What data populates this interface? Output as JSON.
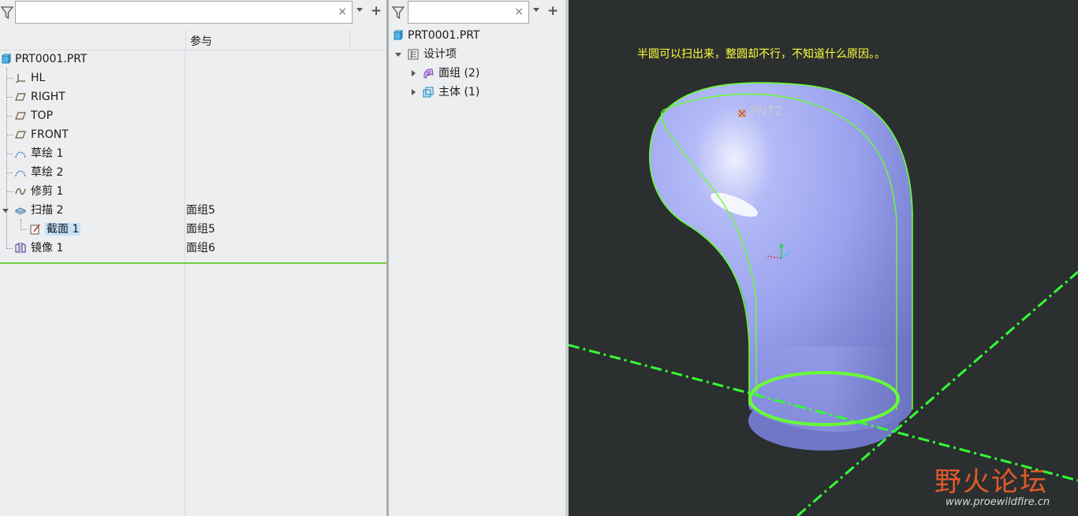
{
  "left_panel": {
    "search": {
      "value": "",
      "clear": "×"
    },
    "column_header": "参与",
    "tree": [
      {
        "label": "PRT0001.PRT",
        "value": "",
        "icon": "part-icon"
      },
      {
        "label": "HL",
        "value": "",
        "icon": "csys-icon"
      },
      {
        "label": "RIGHT",
        "value": "",
        "icon": "datum-plane-icon"
      },
      {
        "label": "TOP",
        "value": "",
        "icon": "datum-plane-icon"
      },
      {
        "label": "FRONT",
        "value": "",
        "icon": "datum-plane-icon"
      },
      {
        "label": "草绘 1",
        "value": "",
        "icon": "sketch-icon"
      },
      {
        "label": "草绘 2",
        "value": "",
        "icon": "sketch-icon"
      },
      {
        "label": "修剪 1",
        "value": "",
        "icon": "trim-icon"
      },
      {
        "label": "扫描 2",
        "value": "面组5",
        "icon": "sweep-icon"
      },
      {
        "label": "截面 1",
        "value": "面组5",
        "icon": "section-icon"
      },
      {
        "label": "镜像 1",
        "value": "面组6",
        "icon": "mirror-icon"
      }
    ]
  },
  "mid_panel": {
    "search": {
      "value": "",
      "clear": "×"
    },
    "tree": [
      {
        "label": "PRT0001.PRT",
        "icon": "part-icon"
      },
      {
        "label": "设计项",
        "icon": "design-items-icon"
      },
      {
        "label": "面组 (2)",
        "icon": "quilt-icon"
      },
      {
        "label": "主体 (1)",
        "icon": "body-icon"
      }
    ]
  },
  "viewport": {
    "annotation": "半圆可以扫出来，整圆却不行，不知道什么原因。。",
    "point_label": "PNT2",
    "watermark_title": "野火论坛",
    "watermark_url": "www.proewildfire.cn",
    "colors": {
      "background": "#2b2f30",
      "surface": "#9aa2ef",
      "curves": "#66ff33",
      "annotation": "#ffff3a"
    }
  }
}
